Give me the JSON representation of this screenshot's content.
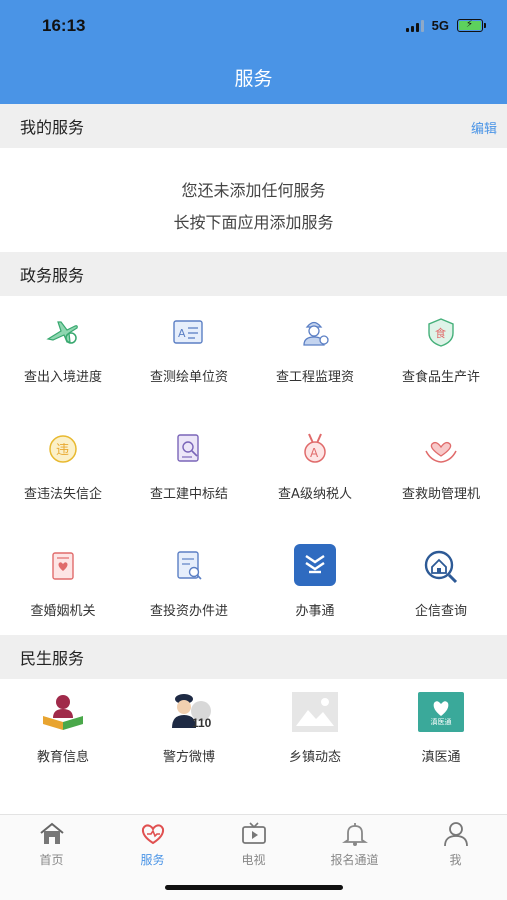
{
  "status_bar": {
    "time": "16:13",
    "network": "5G"
  },
  "header": {
    "title": "服务"
  },
  "my_services": {
    "title": "我的服务",
    "edit_label": "编辑",
    "empty_line1": "您还未添加任何服务",
    "empty_line2": "长按下面应用添加服务"
  },
  "gov_services": {
    "title": "政务服务",
    "items": [
      {
        "label": "查出入境进度",
        "icon": "airplane-icon"
      },
      {
        "label": "查测绘单位资",
        "icon": "map-certificate-icon"
      },
      {
        "label": "查工程监理资",
        "icon": "engineer-icon"
      },
      {
        "label": "查食品生产许",
        "icon": "food-shield-icon"
      },
      {
        "label": "查违法失信企",
        "icon": "violation-icon"
      },
      {
        "label": "查工建中标结",
        "icon": "bid-document-icon"
      },
      {
        "label": "查A级纳税人",
        "icon": "medal-icon"
      },
      {
        "label": "查救助管理机",
        "icon": "helping-hands-icon"
      },
      {
        "label": "查婚姻机关",
        "icon": "marriage-certificate-icon"
      },
      {
        "label": "查投资办件进",
        "icon": "investment-search-icon"
      },
      {
        "label": "办事通",
        "icon": "banshitong-logo-icon"
      },
      {
        "label": "企信查询",
        "icon": "enterprise-search-icon"
      }
    ]
  },
  "livelihood_services": {
    "title": "民生服务",
    "items": [
      {
        "label": "教育信息",
        "icon": "education-icon"
      },
      {
        "label": "警方微博",
        "icon": "police-icon",
        "badge": "110"
      },
      {
        "label": "乡镇动态",
        "icon": "image-placeholder-icon"
      },
      {
        "label": "滇医通",
        "icon": "dianyitong-logo-icon",
        "badge": "滇医通"
      }
    ]
  },
  "tabbar": {
    "items": [
      {
        "label": "首页",
        "icon": "home-icon",
        "active": false
      },
      {
        "label": "服务",
        "icon": "service-heart-icon",
        "active": true
      },
      {
        "label": "电视",
        "icon": "tv-icon",
        "active": false
      },
      {
        "label": "报名通道",
        "icon": "bell-icon",
        "active": false
      },
      {
        "label": "我",
        "icon": "profile-icon",
        "active": false
      }
    ]
  },
  "colors": {
    "brand": "#4a94e6",
    "section_bg": "#efefef"
  }
}
